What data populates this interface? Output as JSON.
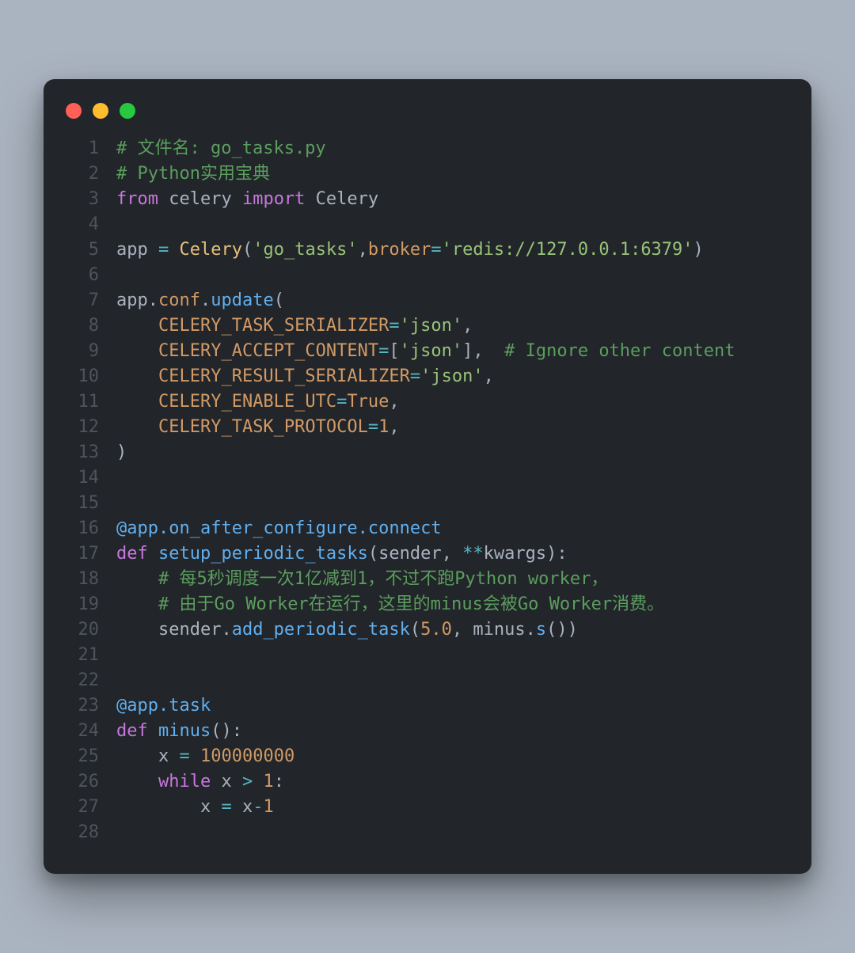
{
  "lines": [
    {
      "n": "1",
      "tokens": [
        [
          "tok-comment",
          "# 文件名: go_tasks.py"
        ]
      ]
    },
    {
      "n": "2",
      "tokens": [
        [
          "tok-comment",
          "# Python实用宝典"
        ]
      ]
    },
    {
      "n": "3",
      "tokens": [
        [
          "tok-keyword",
          "from"
        ],
        [
          "tok-ident",
          " celery "
        ],
        [
          "tok-keyword",
          "import"
        ],
        [
          "tok-ident",
          " Celery"
        ]
      ]
    },
    {
      "n": "4",
      "tokens": [
        [
          "",
          ""
        ]
      ]
    },
    {
      "n": "5",
      "tokens": [
        [
          "tok-ident",
          "app "
        ],
        [
          "tok-op",
          "="
        ],
        [
          "tok-ident",
          " "
        ],
        [
          "tok-class",
          "Celery"
        ],
        [
          "tok-punct",
          "("
        ],
        [
          "tok-string",
          "'go_tasks'"
        ],
        [
          "tok-punct",
          ","
        ],
        [
          "tok-attr",
          "broker"
        ],
        [
          "tok-op",
          "="
        ],
        [
          "tok-string",
          "'redis://127.0.0.1:6379'"
        ],
        [
          "tok-punct",
          ")"
        ]
      ]
    },
    {
      "n": "6",
      "tokens": [
        [
          "",
          ""
        ]
      ]
    },
    {
      "n": "7",
      "tokens": [
        [
          "tok-ident",
          "app"
        ],
        [
          "tok-punct",
          "."
        ],
        [
          "tok-attr",
          "conf"
        ],
        [
          "tok-punct",
          "."
        ],
        [
          "tok-call",
          "update"
        ],
        [
          "tok-punct",
          "("
        ]
      ]
    },
    {
      "n": "8",
      "tokens": [
        [
          "tok-ident",
          "    "
        ],
        [
          "tok-attr",
          "CELERY_TASK_SERIALIZER"
        ],
        [
          "tok-op",
          "="
        ],
        [
          "tok-string",
          "'json'"
        ],
        [
          "tok-punct",
          ","
        ]
      ]
    },
    {
      "n": "9",
      "tokens": [
        [
          "tok-ident",
          "    "
        ],
        [
          "tok-attr",
          "CELERY_ACCEPT_CONTENT"
        ],
        [
          "tok-op",
          "="
        ],
        [
          "tok-punct",
          "["
        ],
        [
          "tok-string",
          "'json'"
        ],
        [
          "tok-punct",
          "],  "
        ],
        [
          "tok-comment",
          "# Ignore other content"
        ]
      ]
    },
    {
      "n": "10",
      "tokens": [
        [
          "tok-ident",
          "    "
        ],
        [
          "tok-attr",
          "CELERY_RESULT_SERIALIZER"
        ],
        [
          "tok-op",
          "="
        ],
        [
          "tok-string",
          "'json'"
        ],
        [
          "tok-punct",
          ","
        ]
      ]
    },
    {
      "n": "11",
      "tokens": [
        [
          "tok-ident",
          "    "
        ],
        [
          "tok-attr",
          "CELERY_ENABLE_UTC"
        ],
        [
          "tok-op",
          "="
        ],
        [
          "tok-const",
          "True"
        ],
        [
          "tok-punct",
          ","
        ]
      ]
    },
    {
      "n": "12",
      "tokens": [
        [
          "tok-ident",
          "    "
        ],
        [
          "tok-attr",
          "CELERY_TASK_PROTOCOL"
        ],
        [
          "tok-op",
          "="
        ],
        [
          "tok-number",
          "1"
        ],
        [
          "tok-punct",
          ","
        ]
      ]
    },
    {
      "n": "13",
      "tokens": [
        [
          "tok-punct",
          ")"
        ]
      ]
    },
    {
      "n": "14",
      "tokens": [
        [
          "",
          ""
        ]
      ]
    },
    {
      "n": "15",
      "tokens": [
        [
          "",
          ""
        ]
      ]
    },
    {
      "n": "16",
      "tokens": [
        [
          "tok-decor",
          "@app.on_after_configure.connect"
        ]
      ]
    },
    {
      "n": "17",
      "tokens": [
        [
          "tok-keyword",
          "def"
        ],
        [
          "tok-ident",
          " "
        ],
        [
          "tok-func",
          "setup_periodic_tasks"
        ],
        [
          "tok-punct",
          "("
        ],
        [
          "tok-param",
          "sender"
        ],
        [
          "tok-punct",
          ", "
        ],
        [
          "tok-op",
          "**"
        ],
        [
          "tok-param",
          "kwargs"
        ],
        [
          "tok-punct",
          "):"
        ]
      ]
    },
    {
      "n": "18",
      "tokens": [
        [
          "tok-ident",
          "    "
        ],
        [
          "tok-comment",
          "# 每5秒调度一次1亿减到1，不过不跑Python worker，"
        ]
      ]
    },
    {
      "n": "19",
      "tokens": [
        [
          "tok-ident",
          "    "
        ],
        [
          "tok-comment",
          "# 由于Go Worker在运行，这里的minus会被Go Worker消费。"
        ]
      ]
    },
    {
      "n": "20",
      "tokens": [
        [
          "tok-ident",
          "    sender"
        ],
        [
          "tok-punct",
          "."
        ],
        [
          "tok-call",
          "add_periodic_task"
        ],
        [
          "tok-punct",
          "("
        ],
        [
          "tok-number",
          "5.0"
        ],
        [
          "tok-punct",
          ", "
        ],
        [
          "tok-ident",
          "minus"
        ],
        [
          "tok-punct",
          "."
        ],
        [
          "tok-call",
          "s"
        ],
        [
          "tok-punct",
          "())"
        ]
      ]
    },
    {
      "n": "21",
      "tokens": [
        [
          "",
          ""
        ]
      ]
    },
    {
      "n": "22",
      "tokens": [
        [
          "",
          ""
        ]
      ]
    },
    {
      "n": "23",
      "tokens": [
        [
          "tok-decor",
          "@app.task"
        ]
      ]
    },
    {
      "n": "24",
      "tokens": [
        [
          "tok-keyword",
          "def"
        ],
        [
          "tok-ident",
          " "
        ],
        [
          "tok-func",
          "minus"
        ],
        [
          "tok-punct",
          "():"
        ]
      ]
    },
    {
      "n": "25",
      "tokens": [
        [
          "tok-ident",
          "    x "
        ],
        [
          "tok-op",
          "="
        ],
        [
          "tok-ident",
          " "
        ],
        [
          "tok-number",
          "100000000"
        ]
      ]
    },
    {
      "n": "26",
      "tokens": [
        [
          "tok-ident",
          "    "
        ],
        [
          "tok-keyword",
          "while"
        ],
        [
          "tok-ident",
          " x "
        ],
        [
          "tok-op",
          ">"
        ],
        [
          "tok-ident",
          " "
        ],
        [
          "tok-number",
          "1"
        ],
        [
          "tok-punct",
          ":"
        ]
      ]
    },
    {
      "n": "27",
      "tokens": [
        [
          "tok-ident",
          "        x "
        ],
        [
          "tok-op",
          "="
        ],
        [
          "tok-ident",
          " x"
        ],
        [
          "tok-op",
          "-"
        ],
        [
          "tok-number",
          "1"
        ]
      ]
    },
    {
      "n": "28",
      "tokens": [
        [
          "",
          ""
        ]
      ]
    }
  ]
}
